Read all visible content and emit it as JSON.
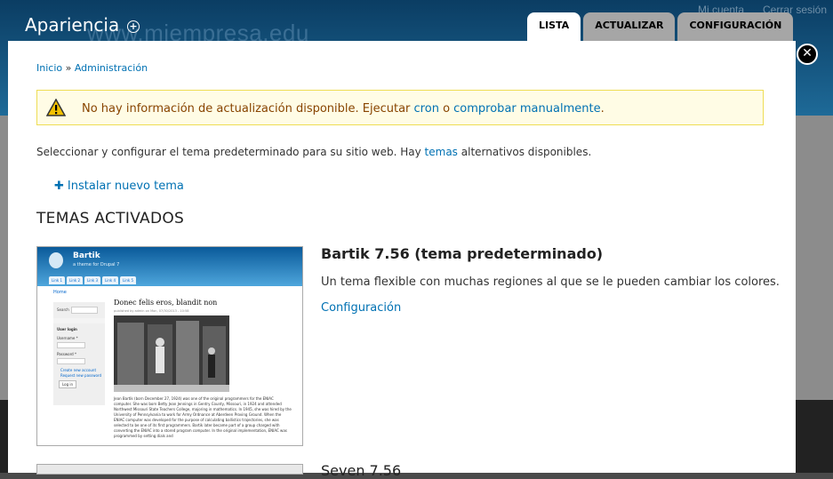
{
  "background": {
    "site_name": "www.miempresa.edu",
    "links": [
      "Mi cuenta",
      "Cerrar sesión"
    ]
  },
  "overlay": {
    "title": "Apariencia",
    "add_icon": "plus-circle-icon",
    "tabs": [
      {
        "label": "LISTA",
        "active": true
      },
      {
        "label": "ACTUALIZAR",
        "active": false
      },
      {
        "label": "CONFIGURACIÓN",
        "active": false
      }
    ],
    "close_icon": "close-icon"
  },
  "breadcrumb": {
    "home": "Inicio",
    "separator": "»",
    "admin": "Administración"
  },
  "message": {
    "icon": "warning-icon",
    "text_before": "No hay información de actualización disponible. Ejecutar ",
    "link_cron": "cron",
    "text_mid": " o ",
    "link_manual": "comprobar manualmente",
    "text_after": "."
  },
  "intro": {
    "text_before": "Seleccionar y configurar el tema predeterminado para su sitio web. Hay ",
    "link": "temas",
    "text_after": " alternativos disponibles."
  },
  "install_link": "Instalar nuevo tema",
  "section_title": "TEMAS ACTIVADOS",
  "themes": [
    {
      "name": "Bartik 7.56 (tema predeterminado)",
      "description": "Un tema flexible con muchas regiones al que se le pueden cambiar los colores.",
      "config_link": "Configuración",
      "preview": {
        "site_name": "Bartik",
        "slogan": "a theme for Drupal 7",
        "tabs": [
          "Link 1",
          "Link 2",
          "Link 3",
          "Link 4",
          "Link 5"
        ],
        "home": "Home",
        "search_label": "Search",
        "user_login": "User login",
        "username": "Username *",
        "password": "Password *",
        "create_account": "Create new account",
        "request_password": "Request new password",
        "login_button": "Log in",
        "article_title": "Donec felis eros, blandit non",
        "meta": "published by admin on Mon, 07/30/2013 - 10:58",
        "body": "Jean Bartik (born December 27, 1924) was one of the original programmers for the ENIAC computer. She was born Betty Jean Jennings in Gentry County, Missouri, in 1924 and attended Northwest Missouri State Teachers College, majoring in mathematics. In 1945, she was hired by the University of Pennsylvania to work for Army Ordnance at Aberdeen Proving Ground. When the ENIAC computer was developed for the purpose of calculating ballistics trajectories, she was selected to be one of its first programmers. Bartik later became part of a group charged with converting the ENIAC into a stored program computer. In the original implementation, ENIAC was programmed by setting dials and"
      }
    },
    {
      "name": "Seven 7.56"
    }
  ],
  "colors": {
    "link": "#0071b3",
    "warning_bg": "#fffce5",
    "warning_text": "#884400",
    "header": "#1e6a98"
  }
}
